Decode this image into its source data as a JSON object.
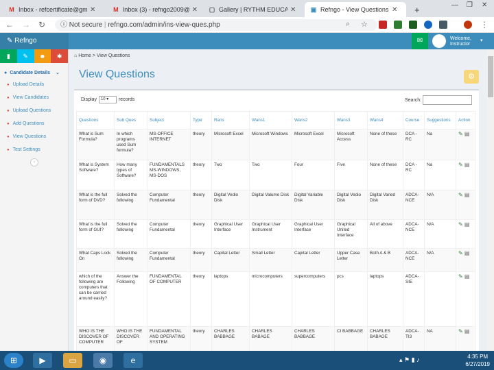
{
  "browser": {
    "tabs": [
      {
        "label": "Inbox - refcertificate@gma",
        "icon": "gmail-icon",
        "active": false
      },
      {
        "label": "Inbox (3) - refngo2009@gm",
        "icon": "gmail-icon",
        "active": false
      },
      {
        "label": "Gallery | RYTHM EDUCATIO",
        "icon": "page-icon",
        "active": false
      },
      {
        "label": "Refngo - View Questions",
        "icon": "page-icon",
        "active": true
      }
    ],
    "new_tab": "+",
    "not_secure": "Not secure",
    "url": "refngo.com/admin/ins-view-ques.php"
  },
  "app": {
    "brand": "Refngo",
    "user_line1": "Welcome,",
    "user_line2": "Instructor"
  },
  "sidebar": {
    "menu_head": "Candidate Details",
    "items": [
      "Upload Details",
      "View Candidates",
      "Upload Questions",
      "Add Questions",
      "View Questions",
      "Test Settings"
    ]
  },
  "content": {
    "breadcrumb_home": "Home",
    "breadcrumb_sep": ">",
    "breadcrumb_current": "View Questions",
    "title": "View Questions",
    "display_label": "Display",
    "display_value": "10",
    "records_label": "records",
    "search_label": "Search:",
    "columns": [
      "Questions",
      "Sub Ques",
      "Subject",
      "Type",
      "Rans",
      "Wans1",
      "Wans2",
      "Wans3",
      "Wans4",
      "Course",
      "Suggestions",
      "Action"
    ],
    "rows": [
      [
        "What is Sum Formula?",
        "In which programs used Sum formula?",
        "MS-OFFICE INTERNET",
        "theory",
        "Microsoft Excel",
        "Microsoft Windows",
        "Microsoft Excel",
        "Microsoft Access",
        "None of these",
        "DCA - RC",
        "Na"
      ],
      [
        "What is System Software?",
        "How many types of Software?",
        "FUNDAMENTALS MS-WINDOWS, MS-DOS",
        "theory",
        "Two",
        "Two",
        "Four",
        "Five",
        "None of these",
        "DCA - RC",
        "Na"
      ],
      [
        "What is the full form of DVD?",
        "Solved the following",
        "Computer Fundamental",
        "theory",
        "Digital Vedio Disk",
        "Digital Valume Disk",
        "Digital Variable Disk",
        "Digital Vedio Disk",
        "Digital Varied Disk",
        "ADCA-NCE",
        "N/A"
      ],
      [
        "What is the full form of GUI?",
        "Solved the following",
        "Computer Fundamental",
        "theory",
        "Graphical User Interface",
        "Graphical User Instrument",
        "Graphical User Interface",
        "Graphical United Interface",
        "All of above",
        "ADCA-NCE",
        "N/A"
      ],
      [
        "What Caps Lock On",
        "Solved the following",
        "Computer Fundamental",
        "theory",
        "Capital Letter",
        "Small Letter",
        "Capital Letter",
        "Upper Case Letter",
        "Both A & B",
        "ADCA-NCE",
        "N/A"
      ],
      [
        "which of the following are computers that can be carried around easily?",
        "Answer the Following",
        "FUNDAMENTAL OF COMPUTER",
        "theory",
        "laptops",
        "microcomputers",
        "supercomputers",
        "pcs",
        "laptops",
        "ADCA-SIE",
        ""
      ],
      [
        "WHO IS THE DISCOVER OF COMPUTER",
        "WHO IS THE DISCOVER OF",
        "FUNDAMENTAL AND OPERATING SYSTEM",
        "theory",
        "CHARLES BABBAGE",
        "CHARLES BABAGE",
        "CHARLES BABBAGE",
        "CI BABBAGE",
        "CHARLES BABAGE",
        "ADCA-TI3",
        "NA"
      ]
    ]
  },
  "taskbar": {
    "time": "4:35 PM",
    "date": "6/27/2019"
  }
}
